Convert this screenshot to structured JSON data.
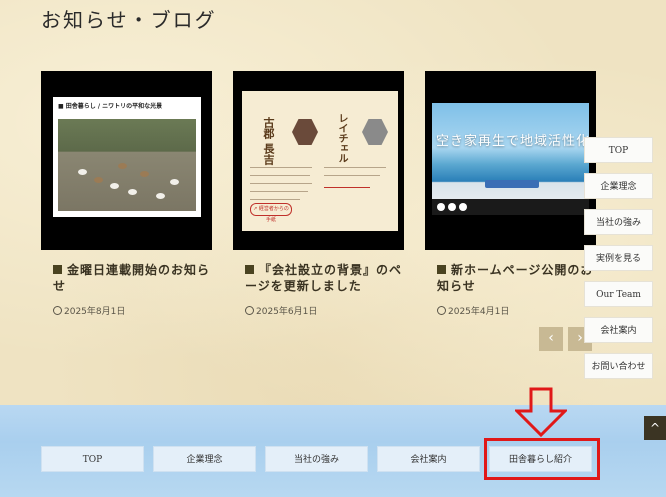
{
  "section": {
    "title": "お知らせ・ブログ"
  },
  "cards": [
    {
      "title": "金曜日連載開始のお知らせ",
      "date": "2025年8月1日",
      "thumb_caption": "■ 田舎暮らし / ニワトリの平和な光景"
    },
    {
      "title": "『会社設立の背景』のページを更新しました",
      "date": "2025年6月1日",
      "thumb_left_name": "古郡 長吉",
      "thumb_right_name": "レイチェル",
      "thumb_button": "↗ 経営者からの手紙"
    },
    {
      "title": "新ホームページ公開のお知らせ",
      "date": "2025年4月1日",
      "thumb_headline": "空き家再生で地域活性化"
    }
  ],
  "carousel": {
    "prev_icon": "‹",
    "next_icon": "›"
  },
  "side_nav": {
    "items": [
      "TOP",
      "企業理念",
      "当社の強み",
      "実例を見る",
      "Our Team",
      "会社案内",
      "お問い合わせ"
    ]
  },
  "footer_nav": {
    "items": [
      "TOP",
      "企業理念",
      "当社の強み",
      "会社案内",
      "田舎暮らし紹介"
    ]
  },
  "scroll_top": {
    "icon": "^"
  },
  "colors": {
    "highlight": "#e01818",
    "footer_bg": "#b9d8f2",
    "accent": "#4a4320"
  }
}
